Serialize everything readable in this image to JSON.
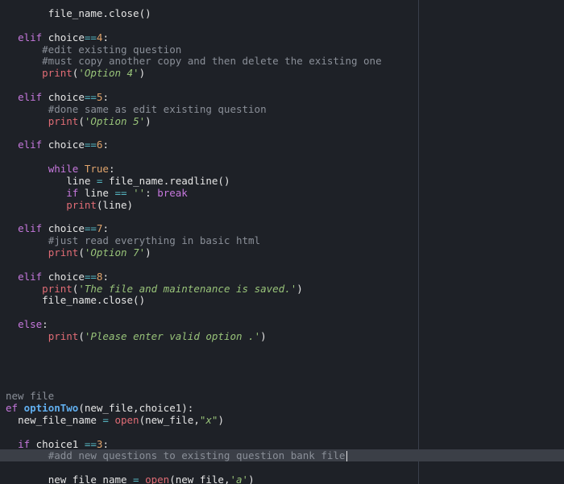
{
  "editor": {
    "lines": [
      {
        "indent": "       ",
        "tokens": [
          [
            "text",
            "file_name.close()"
          ]
        ]
      },
      {
        "indent": "",
        "tokens": []
      },
      {
        "indent": "  ",
        "tokens": [
          [
            "kw",
            "elif"
          ],
          [
            "text",
            " choice"
          ],
          [
            "op",
            "=="
          ],
          [
            "num",
            "4"
          ],
          [
            "text",
            ":"
          ]
        ]
      },
      {
        "indent": "      ",
        "tokens": [
          [
            "cmt",
            "#edit existing question"
          ]
        ]
      },
      {
        "indent": "      ",
        "tokens": [
          [
            "cmt",
            "#must copy another copy and then delete the existing one"
          ]
        ]
      },
      {
        "indent": "      ",
        "tokens": [
          [
            "builtin",
            "print"
          ],
          [
            "text",
            "("
          ],
          [
            "str",
            "'Option 4'"
          ],
          [
            "text",
            ")"
          ]
        ]
      },
      {
        "indent": "",
        "tokens": []
      },
      {
        "indent": "  ",
        "tokens": [
          [
            "kw",
            "elif"
          ],
          [
            "text",
            " choice"
          ],
          [
            "op",
            "=="
          ],
          [
            "num",
            "5"
          ],
          [
            "text",
            ":"
          ]
        ]
      },
      {
        "indent": "       ",
        "tokens": [
          [
            "cmt",
            "#done same as edit existing question"
          ]
        ]
      },
      {
        "indent": "       ",
        "tokens": [
          [
            "builtin",
            "print"
          ],
          [
            "text",
            "("
          ],
          [
            "str",
            "'Option 5'"
          ],
          [
            "text",
            ")"
          ]
        ]
      },
      {
        "indent": "",
        "tokens": []
      },
      {
        "indent": "  ",
        "tokens": [
          [
            "kw",
            "elif"
          ],
          [
            "text",
            " choice"
          ],
          [
            "op",
            "=="
          ],
          [
            "num",
            "6"
          ],
          [
            "text",
            ":"
          ]
        ]
      },
      {
        "indent": "",
        "tokens": []
      },
      {
        "indent": "       ",
        "tokens": [
          [
            "kw",
            "while"
          ],
          [
            "text",
            " "
          ],
          [
            "num",
            "True"
          ],
          [
            "text",
            ":"
          ]
        ]
      },
      {
        "indent": "          ",
        "tokens": [
          [
            "text",
            "line "
          ],
          [
            "op",
            "="
          ],
          [
            "text",
            " file_name.readline()"
          ]
        ]
      },
      {
        "indent": "          ",
        "tokens": [
          [
            "kw",
            "if"
          ],
          [
            "text",
            " line "
          ],
          [
            "op",
            "=="
          ],
          [
            "text",
            " "
          ],
          [
            "str",
            "''"
          ],
          [
            "text",
            ": "
          ],
          [
            "kw",
            "break"
          ]
        ]
      },
      {
        "indent": "          ",
        "tokens": [
          [
            "builtin",
            "print"
          ],
          [
            "text",
            "(line)"
          ]
        ]
      },
      {
        "indent": "",
        "tokens": []
      },
      {
        "indent": "  ",
        "tokens": [
          [
            "kw",
            "elif"
          ],
          [
            "text",
            " choice"
          ],
          [
            "op",
            "=="
          ],
          [
            "num",
            "7"
          ],
          [
            "text",
            ":"
          ]
        ]
      },
      {
        "indent": "       ",
        "tokens": [
          [
            "cmt",
            "#just read everything in basic html"
          ]
        ]
      },
      {
        "indent": "       ",
        "tokens": [
          [
            "builtin",
            "print"
          ],
          [
            "text",
            "("
          ],
          [
            "str",
            "'Option 7'"
          ],
          [
            "text",
            ")"
          ]
        ]
      },
      {
        "indent": "",
        "tokens": []
      },
      {
        "indent": "  ",
        "tokens": [
          [
            "kw",
            "elif"
          ],
          [
            "text",
            " choice"
          ],
          [
            "op",
            "=="
          ],
          [
            "num",
            "8"
          ],
          [
            "text",
            ":"
          ]
        ]
      },
      {
        "indent": "      ",
        "tokens": [
          [
            "builtin",
            "print"
          ],
          [
            "text",
            "("
          ],
          [
            "str",
            "'The file and maintenance is saved.'"
          ],
          [
            "text",
            ")"
          ]
        ]
      },
      {
        "indent": "      ",
        "tokens": [
          [
            "text",
            "file_name.close()"
          ]
        ]
      },
      {
        "indent": "",
        "tokens": []
      },
      {
        "indent": "  ",
        "tokens": [
          [
            "kw",
            "else"
          ],
          [
            "text",
            ":"
          ]
        ]
      },
      {
        "indent": "       ",
        "tokens": [
          [
            "builtin",
            "print"
          ],
          [
            "text",
            "("
          ],
          [
            "str",
            "'Please enter valid option .'"
          ],
          [
            "text",
            ")"
          ]
        ]
      },
      {
        "indent": "",
        "tokens": []
      },
      {
        "indent": "",
        "tokens": []
      },
      {
        "indent": "",
        "tokens": []
      },
      {
        "indent": "",
        "tokens": []
      },
      {
        "indent": "",
        "tokens": [
          [
            "cmt",
            "new file"
          ]
        ]
      },
      {
        "indent": "",
        "tokens": [
          [
            "def",
            "ef"
          ],
          [
            "text",
            " "
          ],
          [
            "fn",
            "optionTwo"
          ],
          [
            "text",
            "(new_file,choice1):"
          ]
        ]
      },
      {
        "indent": "  ",
        "tokens": [
          [
            "text",
            "new_file_name "
          ],
          [
            "op",
            "="
          ],
          [
            "text",
            " "
          ],
          [
            "builtin",
            "open"
          ],
          [
            "text",
            "(new_file,"
          ],
          [
            "str",
            "\"x\""
          ],
          [
            "text",
            ")"
          ]
        ]
      },
      {
        "indent": "",
        "tokens": []
      },
      {
        "indent": "  ",
        "tokens": [
          [
            "kw",
            "if"
          ],
          [
            "text",
            " choice1 "
          ],
          [
            "op",
            "=="
          ],
          [
            "num",
            "3"
          ],
          [
            "text",
            ":"
          ]
        ]
      },
      {
        "indent": "       ",
        "tokens": [
          [
            "cmt",
            "#add new questions to existing question bank file"
          ]
        ],
        "highlight": true,
        "cursor": true
      },
      {
        "indent": "",
        "tokens": []
      },
      {
        "indent": "       ",
        "tokens": [
          [
            "text",
            "new_file_name "
          ],
          [
            "op",
            "="
          ],
          [
            "text",
            " "
          ],
          [
            "builtin",
            "open"
          ],
          [
            "text",
            "(new_file,"
          ],
          [
            "str",
            "'a'"
          ],
          [
            "text",
            ")"
          ]
        ]
      }
    ]
  },
  "colors": {
    "background": "#1e2127",
    "ruler": "#3a3f4b",
    "current_line": "#3b3f47",
    "keyword": "#c678dd",
    "function_name": "#61afef",
    "builtin": "#e06c75",
    "number": "#e0a46c",
    "string": "#98c379",
    "comment": "#8a8f98",
    "operator": "#56b6c2"
  }
}
